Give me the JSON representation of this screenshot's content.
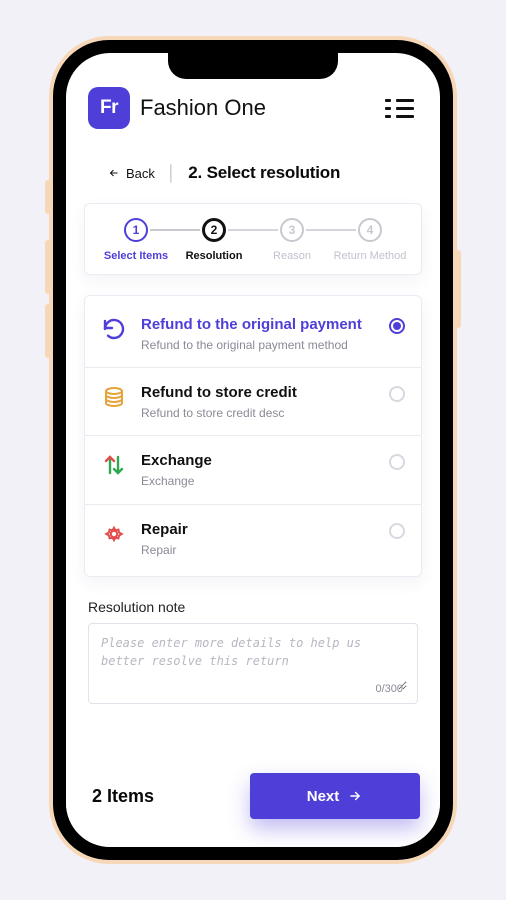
{
  "brand": {
    "logo_text": "Fr",
    "name": "Fashion One"
  },
  "nav": {
    "back_label": "Back",
    "page_title": "2. Select resolution"
  },
  "stepper": {
    "steps": [
      {
        "num": "1",
        "label": "Select Items",
        "state": "done"
      },
      {
        "num": "2",
        "label": "Resolution",
        "state": "active"
      },
      {
        "num": "3",
        "label": "Reason",
        "state": "pending"
      },
      {
        "num": "4",
        "label": "Return Method",
        "state": "pending"
      }
    ]
  },
  "resolutions": [
    {
      "icon": "refresh-icon",
      "color": "#4f3fd9",
      "title": "Refund to the original payment",
      "desc": "Refund to the original payment method",
      "selected": true
    },
    {
      "icon": "coins-icon",
      "color": "#e8a23a",
      "title": "Refund to store credit",
      "desc": "Refund to store credit desc",
      "selected": false
    },
    {
      "icon": "exchange-icon",
      "color": "#2fa84f",
      "title": "Exchange",
      "desc": "Exchange",
      "selected": false
    },
    {
      "icon": "gear-icon",
      "color": "#e44b4b",
      "title": "Repair",
      "desc": "Repair",
      "selected": false
    }
  ],
  "note": {
    "label": "Resolution note",
    "placeholder": "Please enter more details to help us better resolve this return",
    "counter": "0/300",
    "value": ""
  },
  "footer": {
    "item_count": "2 Items",
    "next_label": "Next"
  }
}
